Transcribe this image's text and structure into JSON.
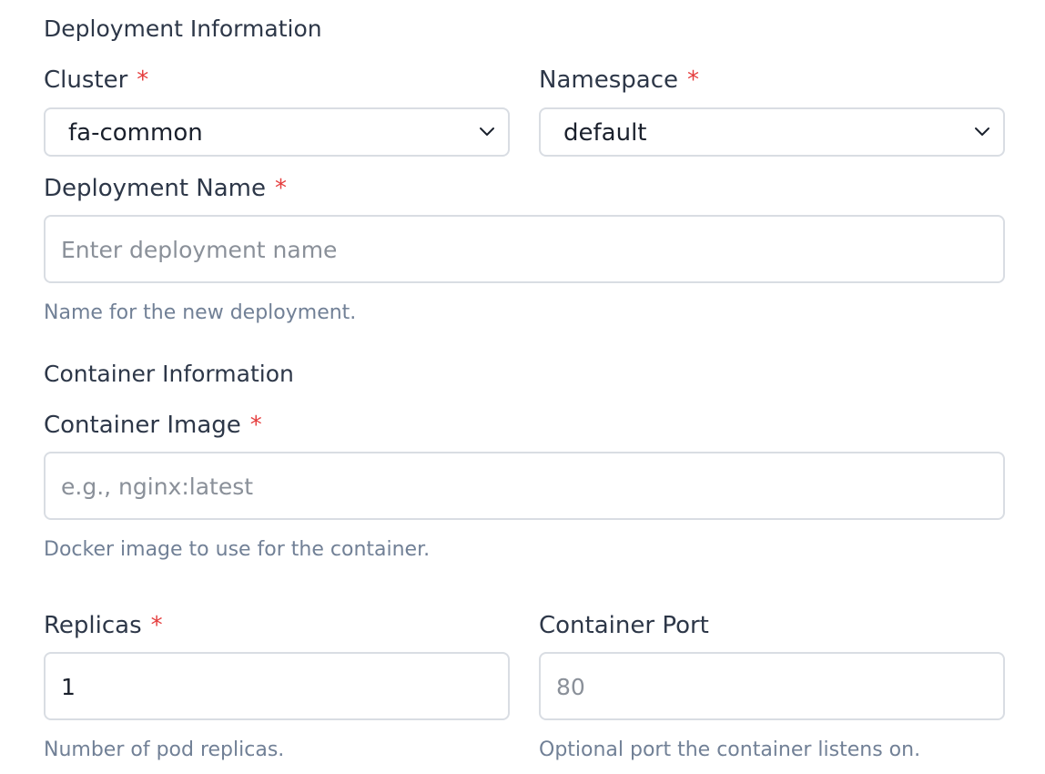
{
  "deployment_section": {
    "title": "Deployment Information",
    "cluster": {
      "label": "Cluster",
      "required_mark": "*",
      "selected": "fa-common"
    },
    "namespace": {
      "label": "Namespace",
      "required_mark": "*",
      "selected": "default"
    },
    "deployment_name": {
      "label": "Deployment Name",
      "required_mark": "*",
      "placeholder": "Enter deployment name",
      "value": "",
      "help": "Name for the new deployment."
    }
  },
  "container_section": {
    "title": "Container Information",
    "image": {
      "label": "Container Image",
      "required_mark": "*",
      "placeholder": "e.g., nginx:latest",
      "value": "",
      "help": "Docker image to use for the container."
    },
    "replicas": {
      "label": "Replicas",
      "required_mark": "*",
      "value": "1",
      "help": "Number of pod replicas."
    },
    "port": {
      "label": "Container Port",
      "placeholder": "80",
      "value": "",
      "help": "Optional port the container listens on."
    }
  },
  "colors": {
    "text": "#2d3748",
    "required": "#e53e3e",
    "border": "#d9dde3",
    "help_text": "#718096",
    "placeholder": "#8a9099"
  },
  "icons": {
    "select_arrow": "chevron-down-icon"
  }
}
